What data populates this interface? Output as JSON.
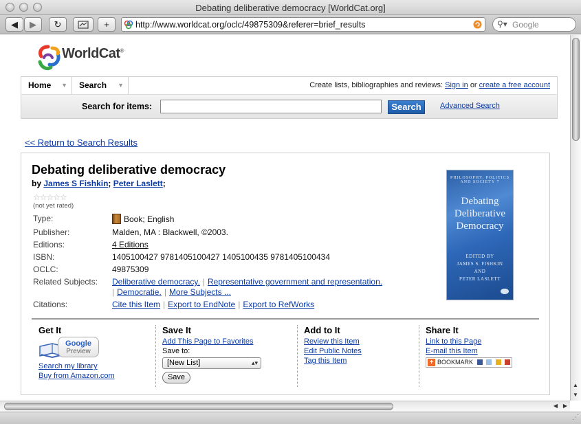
{
  "window": {
    "title": "Debating deliberative democracy [WorldCat.org]"
  },
  "toolbar": {
    "url": "http://www.worldcat.org/oclc/49875309&referer=brief_results",
    "search_placeholder": "Google",
    "add_label": "+"
  },
  "site": {
    "logo_text": "WorldCat",
    "logo_reg": "®"
  },
  "nav": {
    "tabs": [
      {
        "label": "Home"
      },
      {
        "label": "Search"
      }
    ],
    "right_text": "Create lists, bibliographies and reviews:",
    "sign_in": "Sign in",
    "or": "or",
    "create_account": "create a free account"
  },
  "search": {
    "label": "Search for items:",
    "value": "",
    "button": "Search",
    "advanced": "Advanced Search"
  },
  "return_link": "<< Return to Search Results",
  "record": {
    "title": "Debating deliberative democracy",
    "by": "by",
    "authors": [
      "James S Fishkin",
      "Peter Laslett"
    ],
    "rating_stars": "☆☆☆☆☆",
    "rating_note": "(not yet rated)",
    "fields": {
      "type_label": "Type:",
      "type_value": "Book; English",
      "publisher_label": "Publisher:",
      "publisher_value": "Malden, MA : Blackwell, ©2003.",
      "editions_label": "Editions:",
      "editions_value": "4 Editions",
      "isbn_label": "ISBN:",
      "isbn_value": "1405100427 9781405100427 1405100435 9781405100434",
      "oclc_label": "OCLC:",
      "oclc_value": "49875309",
      "subjects_label": "Related Subjects:",
      "subjects": [
        "Deliberative democracy.",
        "Representative government and representation.",
        "Democratie.",
        "More Subjects ..."
      ],
      "citations_label": "Citations:",
      "citations": [
        "Cite this Item",
        "Export to EndNote",
        "Export to RefWorks"
      ]
    },
    "cover": {
      "series": "PHILOSOPHY, POLITICS AND SOCIETY 7",
      "title_lines": [
        "Debating",
        "Deliberative",
        "Democracy"
      ],
      "edited_by": "EDITED BY",
      "editor1": "JAMES S. FISHKIN",
      "and": "AND",
      "editor2": "PETER LASLETT"
    }
  },
  "actions": {
    "get_it": {
      "heading": "Get It",
      "google_preview_1": "Google",
      "google_preview_2": "Preview",
      "links": [
        "Search my library",
        "Buy from Amazon.com"
      ]
    },
    "save_it": {
      "heading": "Save It",
      "favorites": "Add This Page to Favorites",
      "save_to": "Save to:",
      "select_value": "[New List]",
      "save_button": "Save"
    },
    "add_to_it": {
      "heading": "Add to It",
      "links": [
        "Review this Item",
        "Edit Public Notes",
        "Tag this Item"
      ]
    },
    "share_it": {
      "heading": "Share It",
      "links": [
        "Link to this Page",
        "E-mail this Item"
      ],
      "bookmark": "BOOKMARK"
    }
  },
  "colors": {
    "link": "#0b3aa3",
    "search_button": "#2a6ab8",
    "cover_blue": "#2e68b8"
  }
}
